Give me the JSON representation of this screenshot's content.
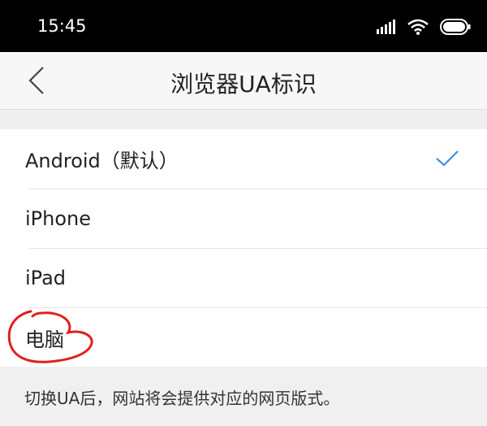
{
  "status_bar": {
    "time": "15:45",
    "icons": [
      "signal-icon",
      "wifi-icon",
      "battery-icon"
    ]
  },
  "nav": {
    "back_icon": "chevron-left-icon",
    "title": "浏览器UA标识"
  },
  "options": [
    {
      "label": "Android（默认）",
      "selected": true
    },
    {
      "label": "iPhone",
      "selected": false
    },
    {
      "label": "iPad",
      "selected": false
    },
    {
      "label": "电脑",
      "selected": false
    }
  ],
  "hint": "切换UA后，网站将会提供对应的网页版式。",
  "colors": {
    "accent": "#3d8ee8",
    "annotation": "#e0201a"
  }
}
